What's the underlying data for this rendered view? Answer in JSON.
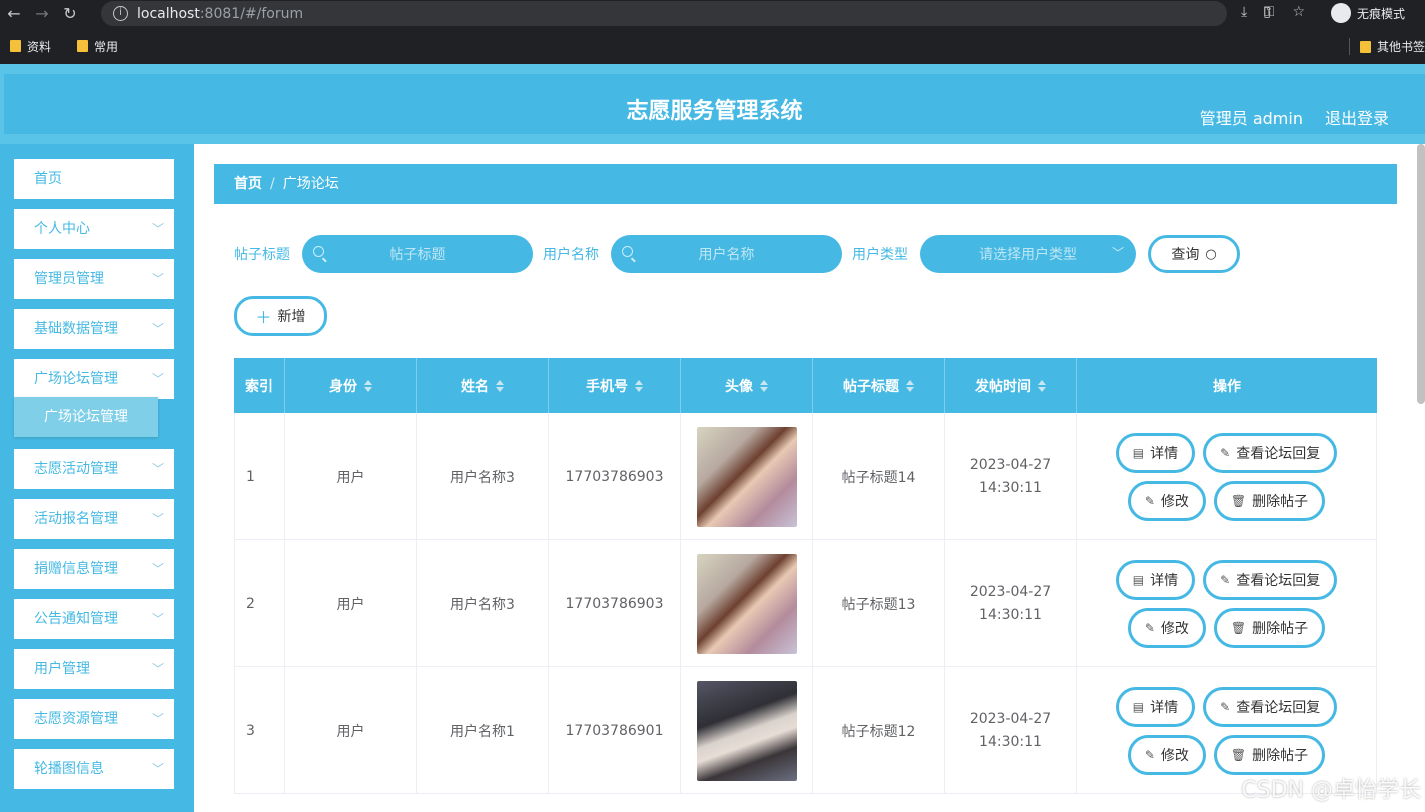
{
  "browser": {
    "url_host": "localhost",
    "url_path": ":8081/#/forum",
    "bookmarks": [
      "资料",
      "常用"
    ],
    "bookmark_other": "其他书签",
    "incognito_label": "无痕模式"
  },
  "header": {
    "title": "志愿服务管理系统",
    "user_label": "管理员 admin",
    "logout_label": "退出登录"
  },
  "sidebar": {
    "items": [
      {
        "label": "首页"
      },
      {
        "label": "个人中心"
      },
      {
        "label": "管理员管理"
      },
      {
        "label": "基础数据管理"
      },
      {
        "label": "广场论坛管理"
      },
      {
        "label": "志愿活动管理"
      },
      {
        "label": "活动报名管理"
      },
      {
        "label": "捐赠信息管理"
      },
      {
        "label": "公告通知管理"
      },
      {
        "label": "用户管理"
      },
      {
        "label": "志愿资源管理"
      },
      {
        "label": "轮播图信息"
      }
    ],
    "active_sub": "广场论坛管理"
  },
  "breadcrumb": {
    "home": "首页",
    "sep": "/",
    "current": "广场论坛"
  },
  "search": {
    "title_label": "帖子标题",
    "title_placeholder": "帖子标题",
    "user_label": "用户名称",
    "user_placeholder": "用户名称",
    "type_label": "用户类型",
    "type_placeholder": "请选择用户类型",
    "query_label": "查询",
    "add_label": "新增"
  },
  "table": {
    "headers": [
      "索引",
      "身份",
      "姓名",
      "手机号",
      "头像",
      "帖子标题",
      "发帖时间",
      "操作"
    ],
    "rows": [
      {
        "index": "1",
        "role": "用户",
        "name": "用户名称3",
        "phone": "17703786903",
        "avatar": "photo-girl-field",
        "title": "帖子标题14",
        "time": "2023-04-27 14:30:11"
      },
      {
        "index": "2",
        "role": "用户",
        "name": "用户名称3",
        "phone": "17703786903",
        "avatar": "photo-girl-field",
        "title": "帖子标题13",
        "time": "2023-04-27 14:30:11"
      },
      {
        "index": "3",
        "role": "用户",
        "name": "用户名称1",
        "phone": "17703786901",
        "avatar": "photo-girl-dark-hair",
        "title": "帖子标题12",
        "time": "2023-04-27 14:30:11"
      }
    ],
    "actions": {
      "detail": "详情",
      "replies": "查看论坛回复",
      "edit": "修改",
      "delete": "删除帖子"
    }
  },
  "watermark": "CSDN @卓怡学长",
  "colors": {
    "accent": "#45b9e3",
    "header_outer": "#5ac3e8"
  }
}
